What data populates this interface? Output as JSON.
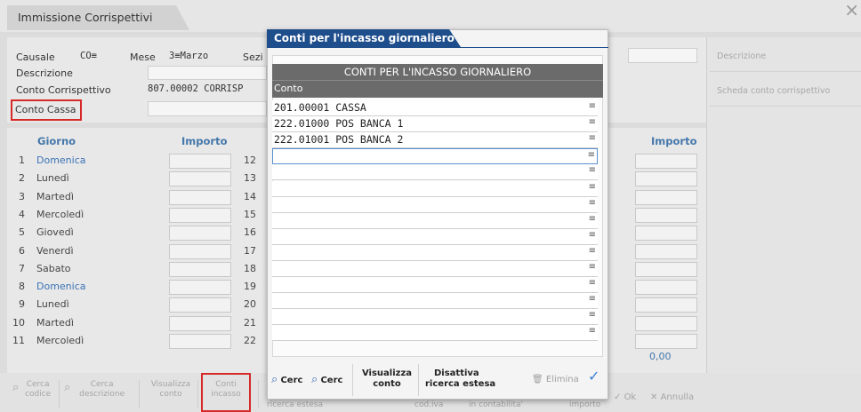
{
  "window": {
    "title": "Immissione Corrispettivi",
    "close_glyph": "×"
  },
  "header": {
    "causale_label": "Causale",
    "causale_value": "CO≡",
    "mese_label": "Mese",
    "mese_value": "3≡Marzo",
    "sez_label": "Sezi",
    "descrizione_label": "Descrizione",
    "conto_corr_label": "Conto Corrispettivo",
    "conto_corr_value": "807.00002 CORRISP",
    "conto_cassa_label": "Conto Cassa"
  },
  "side": {
    "descrizione": "Descrizione",
    "scheda": "Scheda conto corrispettivo"
  },
  "grid": {
    "giorno_header": "Giorno",
    "importo_header": "Importo",
    "importo_header_right": "Importo",
    "days": [
      {
        "n": "1",
        "name": "Domenica",
        "blue": true
      },
      {
        "n": "2",
        "name": "Lunedì",
        "blue": false
      },
      {
        "n": "3",
        "name": "Martedì",
        "blue": false
      },
      {
        "n": "4",
        "name": "Mercoledì",
        "blue": false
      },
      {
        "n": "5",
        "name": "Giovedì",
        "blue": false
      },
      {
        "n": "6",
        "name": "Venerdì",
        "blue": false
      },
      {
        "n": "7",
        "name": "Sabato",
        "blue": false
      },
      {
        "n": "8",
        "name": "Domenica",
        "blue": true
      },
      {
        "n": "9",
        "name": "Lunedì",
        "blue": false
      },
      {
        "n": "10",
        "name": "Martedì",
        "blue": false
      },
      {
        "n": "11",
        "name": "Mercoledì",
        "blue": false
      }
    ],
    "second_col": [
      "12",
      "13",
      "14",
      "15",
      "16",
      "17",
      "18",
      "19",
      "20",
      "21",
      "22"
    ],
    "total": "0,00"
  },
  "toolbar": {
    "cerca_codice": [
      "Cerca",
      "codice"
    ],
    "cerca_descrizione": [
      "Cerca",
      "descrizione"
    ],
    "visualizza_conto": [
      "Visualizza",
      "conto"
    ],
    "conti_incasso": [
      "Conti",
      "incasso"
    ],
    "ricerca_estesa": "ricerca estesa",
    "cod_iva": "cod.iva",
    "in_contabilita": "in contabilita'",
    "importo": "importo",
    "ok": "Ok",
    "annulla": "Annulla"
  },
  "modal": {
    "title": "Conti per l'incasso giornaliero",
    "table_title": "CONTI PER L'INCASSO GIORNALIERO",
    "column": "Conto",
    "rows": [
      "201.00001 CASSA",
      "222.01000 POS BANCA 1",
      "222.01001 POS BANCA 2",
      "",
      "",
      "",
      "",
      "",
      "",
      "",
      "",
      "",
      "",
      "",
      ""
    ],
    "row_mark": "≡",
    "buttons": {
      "cerc1": "Cerc",
      "cerc2": "Cerc",
      "visualizza": [
        "Visualizza",
        "conto"
      ],
      "disattiva": [
        "Disattiva",
        "ricerca estesa"
      ],
      "elimina": "Elimina"
    }
  }
}
